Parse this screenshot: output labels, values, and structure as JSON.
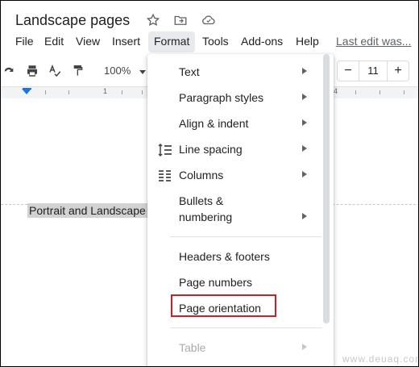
{
  "doc": {
    "title": "Landscape pages",
    "body_text": "Portrait and Landscape"
  },
  "menubar": {
    "items": [
      "File",
      "Edit",
      "View",
      "Insert",
      "Format",
      "Tools",
      "Add-ons",
      "Help"
    ],
    "last_edit": "Last edit was..."
  },
  "toolbar": {
    "zoom": "100%",
    "font_size": "11",
    "minus": "−",
    "plus": "+"
  },
  "ruler": {
    "marks": [
      "1",
      "4"
    ]
  },
  "format_menu": {
    "items": [
      {
        "label": "Text",
        "submenu": true
      },
      {
        "label": "Paragraph styles",
        "submenu": true
      },
      {
        "label": "Align & indent",
        "submenu": true
      },
      {
        "label": "Line spacing",
        "submenu": true,
        "icon": "line-spacing-icon"
      },
      {
        "label": "Columns",
        "submenu": true,
        "icon": "columns-icon"
      },
      {
        "label_line1": "Bullets &",
        "label_line2": "numbering",
        "submenu": true
      },
      {
        "label": "Headers & footers"
      },
      {
        "label": "Page numbers"
      },
      {
        "label": "Page orientation",
        "highlighted": true
      },
      {
        "label": "Table",
        "submenu": true,
        "disabled": true
      }
    ]
  },
  "watermark": "www.deuaq.com",
  "colors": {
    "highlight_box": "#cc1f24",
    "accent": "#1a73e8"
  }
}
